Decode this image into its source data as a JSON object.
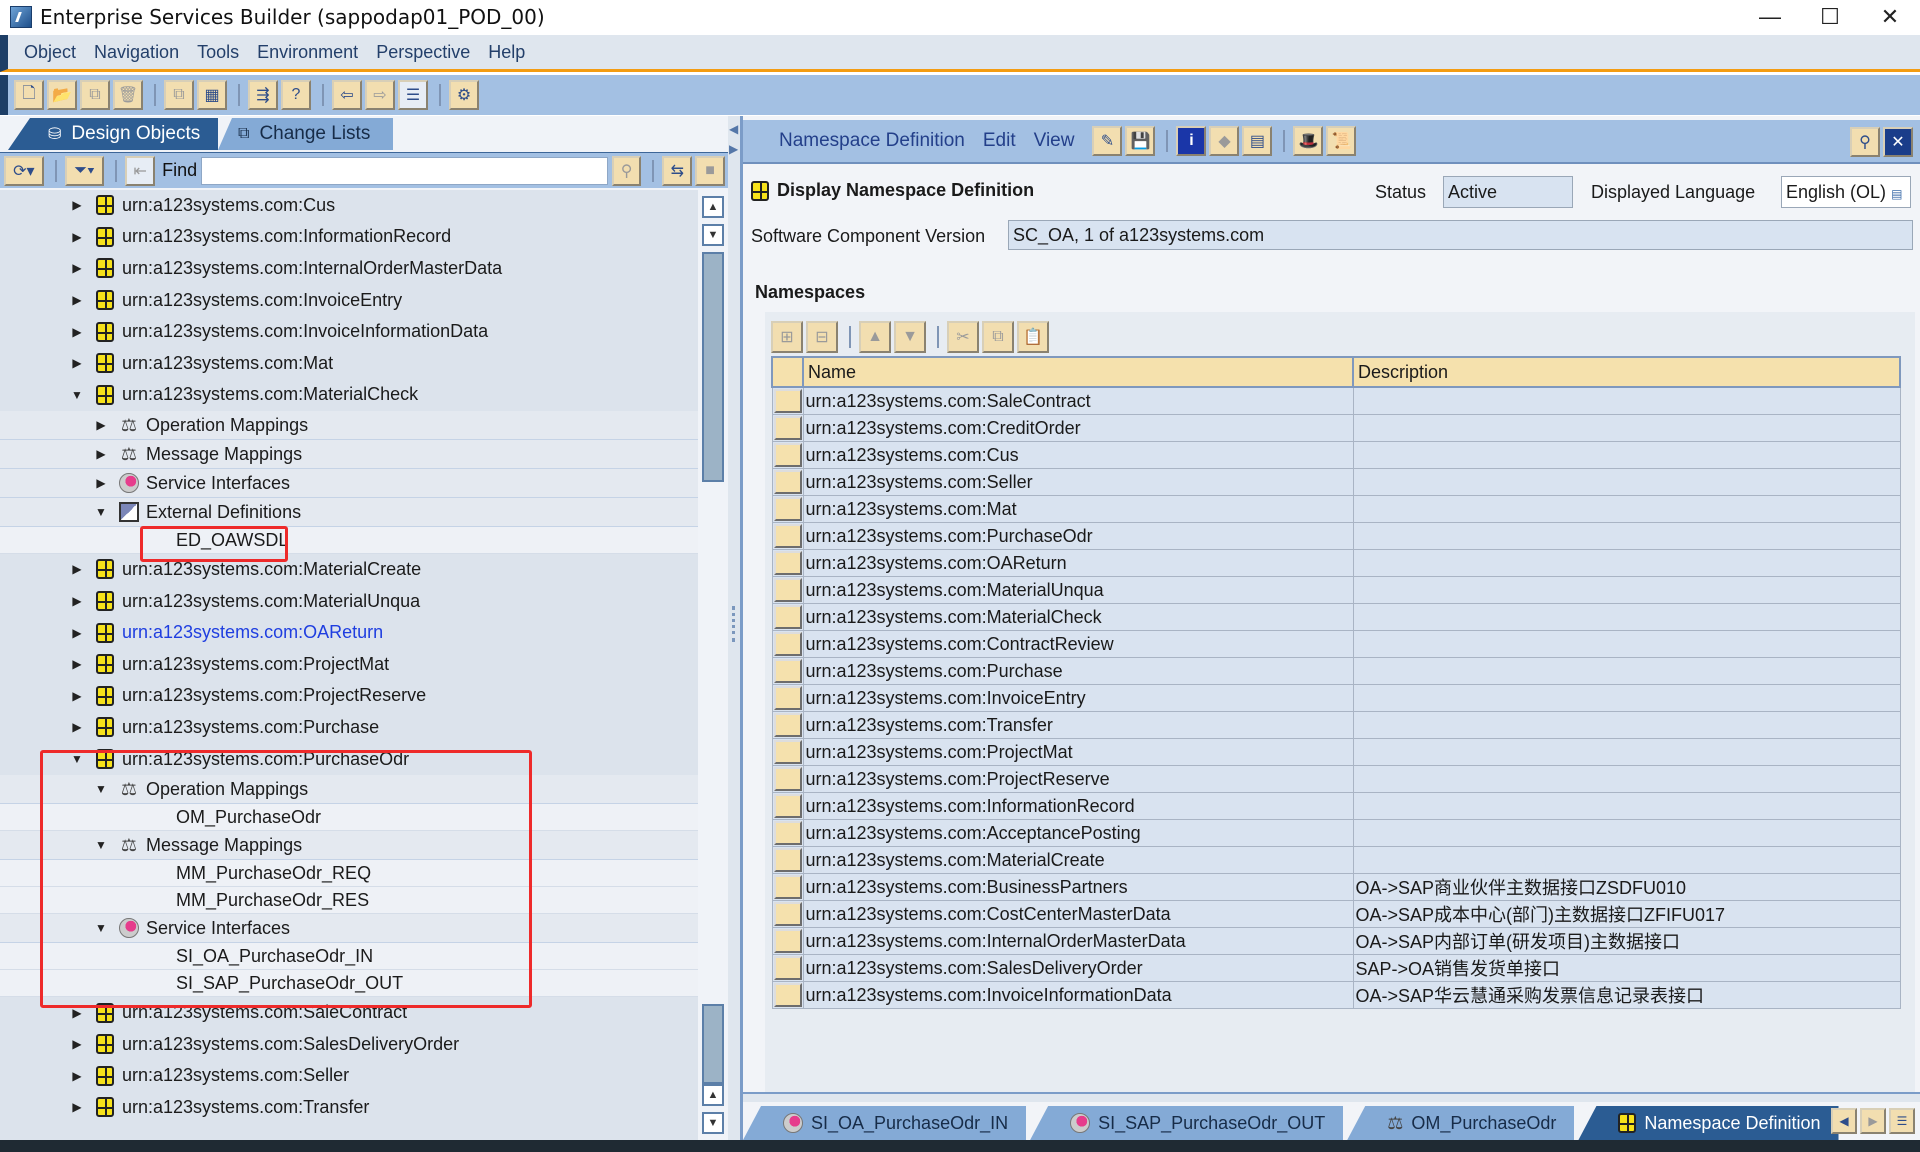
{
  "window": {
    "title": "Enterprise Services Builder (sappodap01_POD_00)",
    "controls": {
      "minimize": "—",
      "maximize": "☐",
      "close": "✕"
    }
  },
  "menubar": {
    "items": [
      {
        "label": "Object",
        "mnemonic": "O"
      },
      {
        "label": "Navigation",
        "mnemonic": "N"
      },
      {
        "label": "Tools",
        "mnemonic": "T"
      },
      {
        "label": "Environment",
        "mnemonic": "E"
      },
      {
        "label": "Perspective",
        "mnemonic": "P"
      },
      {
        "label": "Help",
        "mnemonic": "H"
      }
    ]
  },
  "toolbar": {
    "buttons": [
      {
        "name": "new-object",
        "glyph": "🗋",
        "enabled": true
      },
      {
        "name": "open",
        "glyph": "📂",
        "enabled": false
      },
      {
        "name": "copy",
        "glyph": "⧉",
        "enabled": false
      },
      {
        "name": "delete",
        "glyph": "🗑",
        "enabled": false
      },
      {
        "name": "copy-object",
        "glyph": "⧉",
        "enabled": false
      },
      {
        "name": "close-all",
        "glyph": "▦",
        "enabled": true
      },
      {
        "name": "where-used",
        "glyph": "⇶",
        "enabled": true
      },
      {
        "name": "help-doc",
        "glyph": "?",
        "enabled": true
      },
      {
        "name": "back",
        "glyph": "⇦",
        "enabled": true
      },
      {
        "name": "forward",
        "glyph": "⇨",
        "enabled": false
      },
      {
        "name": "toggle-navigation",
        "glyph": "☰",
        "enabled": true
      },
      {
        "name": "settings",
        "glyph": "⚙",
        "enabled": true
      }
    ]
  },
  "left_panel": {
    "tabs": [
      {
        "label": "Design Objects",
        "active": true,
        "icon": "database-icon"
      },
      {
        "label": "Change Lists",
        "active": false,
        "icon": "change-list-icon"
      }
    ],
    "find": {
      "label": "Find",
      "value": ""
    },
    "tree": [
      {
        "level": 0,
        "type": "namespace",
        "label": "urn:a123systems.com:Cus",
        "expanded": false
      },
      {
        "level": 0,
        "type": "namespace",
        "label": "urn:a123systems.com:InformationRecord",
        "expanded": false
      },
      {
        "level": 0,
        "type": "namespace",
        "label": "urn:a123systems.com:InternalOrderMasterData",
        "expanded": false
      },
      {
        "level": 0,
        "type": "namespace",
        "label": "urn:a123systems.com:InvoiceEntry",
        "expanded": false
      },
      {
        "level": 0,
        "type": "namespace",
        "label": "urn:a123systems.com:InvoiceInformationData",
        "expanded": false
      },
      {
        "level": 0,
        "type": "namespace",
        "label": "urn:a123systems.com:Mat",
        "expanded": false
      },
      {
        "level": 0,
        "type": "namespace",
        "label": "urn:a123systems.com:MaterialCheck",
        "expanded": true
      },
      {
        "level": 1,
        "type": "operation-mappings",
        "label": "Operation Mappings",
        "expanded": false
      },
      {
        "level": 1,
        "type": "message-mappings",
        "label": "Message Mappings",
        "expanded": false
      },
      {
        "level": 1,
        "type": "service-interfaces",
        "label": "Service Interfaces",
        "expanded": false
      },
      {
        "level": 1,
        "type": "external-definitions",
        "label": "External Definitions",
        "expanded": true
      },
      {
        "level": 2,
        "type": "object",
        "label": "ED_OAWSDL",
        "highlighted": true
      },
      {
        "level": 0,
        "type": "namespace",
        "label": "urn:a123systems.com:MaterialCreate",
        "expanded": false
      },
      {
        "level": 0,
        "type": "namespace",
        "label": "urn:a123systems.com:MaterialUnqua",
        "expanded": false
      },
      {
        "level": 0,
        "type": "namespace",
        "label": "urn:a123systems.com:OAReturn",
        "expanded": false,
        "link": true
      },
      {
        "level": 0,
        "type": "namespace",
        "label": "urn:a123systems.com:ProjectMat",
        "expanded": false
      },
      {
        "level": 0,
        "type": "namespace",
        "label": "urn:a123systems.com:ProjectReserve",
        "expanded": false
      },
      {
        "level": 0,
        "type": "namespace",
        "label": "urn:a123systems.com:Purchase",
        "expanded": false
      },
      {
        "level": 0,
        "type": "namespace",
        "label": "urn:a123systems.com:PurchaseOdr",
        "expanded": true,
        "highlighted": true
      },
      {
        "level": 1,
        "type": "operation-mappings",
        "label": "Operation Mappings",
        "expanded": true
      },
      {
        "level": 2,
        "type": "object",
        "label": "OM_PurchaseOdr"
      },
      {
        "level": 1,
        "type": "message-mappings",
        "label": "Message Mappings",
        "expanded": true
      },
      {
        "level": 2,
        "type": "object",
        "label": "MM_PurchaseOdr_REQ"
      },
      {
        "level": 2,
        "type": "object",
        "label": "MM_PurchaseOdr_RES"
      },
      {
        "level": 1,
        "type": "service-interfaces",
        "label": "Service Interfaces",
        "expanded": true
      },
      {
        "level": 2,
        "type": "object",
        "label": "SI_OA_PurchaseOdr_IN"
      },
      {
        "level": 2,
        "type": "object",
        "label": "SI_SAP_PurchaseOdr_OUT"
      },
      {
        "level": 0,
        "type": "namespace",
        "label": "urn:a123systems.com:SaleContract",
        "expanded": false
      },
      {
        "level": 0,
        "type": "namespace",
        "label": "urn:a123systems.com:SalesDeliveryOrder",
        "expanded": false
      },
      {
        "level": 0,
        "type": "namespace",
        "label": "urn:a123systems.com:Seller",
        "expanded": false
      },
      {
        "level": 0,
        "type": "namespace",
        "label": "urn:a123systems.com:Transfer",
        "expanded": false
      }
    ]
  },
  "right_panel": {
    "menu": [
      {
        "label": "Namespace Definition",
        "mnemonic": "a"
      },
      {
        "label": "Edit",
        "mnemonic": "d"
      },
      {
        "label": "View",
        "mnemonic": "V"
      }
    ],
    "heading": "Display Namespace Definition",
    "status_label": "Status",
    "status_value": "Active",
    "language_label": "Displayed Language",
    "language_value": "English (OL)",
    "scv_label": "Software Component Version",
    "scv_value": "SC_OA, 1 of a123systems.com",
    "section_title": "Namespaces",
    "table": {
      "columns": [
        "Name",
        "Description"
      ],
      "rows": [
        {
          "name": "urn:a123systems.com:SaleContract",
          "description": ""
        },
        {
          "name": "urn:a123systems.com:CreditOrder",
          "description": ""
        },
        {
          "name": "urn:a123systems.com:Cus",
          "description": ""
        },
        {
          "name": "urn:a123systems.com:Seller",
          "description": ""
        },
        {
          "name": "urn:a123systems.com:Mat",
          "description": ""
        },
        {
          "name": "urn:a123systems.com:PurchaseOdr",
          "description": ""
        },
        {
          "name": "urn:a123systems.com:OAReturn",
          "description": ""
        },
        {
          "name": "urn:a123systems.com:MaterialUnqua",
          "description": ""
        },
        {
          "name": "urn:a123systems.com:MaterialCheck",
          "description": ""
        },
        {
          "name": "urn:a123systems.com:ContractReview",
          "description": ""
        },
        {
          "name": "urn:a123systems.com:Purchase",
          "description": ""
        },
        {
          "name": "urn:a123systems.com:InvoiceEntry",
          "description": ""
        },
        {
          "name": "urn:a123systems.com:Transfer",
          "description": ""
        },
        {
          "name": "urn:a123systems.com:ProjectMat",
          "description": ""
        },
        {
          "name": "urn:a123systems.com:ProjectReserve",
          "description": ""
        },
        {
          "name": "urn:a123systems.com:InformationRecord",
          "description": ""
        },
        {
          "name": "urn:a123systems.com:AcceptancePosting",
          "description": ""
        },
        {
          "name": "urn:a123systems.com:MaterialCreate",
          "description": ""
        },
        {
          "name": "urn:a123systems.com:BusinessPartners",
          "description": "OA->SAP商业伙伴主数据接口ZSDFU010"
        },
        {
          "name": "urn:a123systems.com:CostCenterMasterData",
          "description": "OA->SAP成本中心(部门)主数据接口ZFIFU017"
        },
        {
          "name": "urn:a123systems.com:InternalOrderMasterData",
          "description": "OA->SAP内部订单(研发项目)主数据接口"
        },
        {
          "name": "urn:a123systems.com:SalesDeliveryOrder",
          "description": "SAP->OA销售发货单接口"
        },
        {
          "name": "urn:a123systems.com:InvoiceInformationData",
          "description": "OA->SAP华云慧通采购发票信息记录表接口"
        }
      ]
    },
    "editor_tabs": [
      {
        "label": "SI_OA_PurchaseOdr_IN",
        "icon": "service-interface-icon",
        "active": false
      },
      {
        "label": "SI_SAP_PurchaseOdr_OUT",
        "icon": "service-interface-icon",
        "active": false
      },
      {
        "label": "OM_PurchaseOdr",
        "icon": "operation-mapping-icon",
        "active": false
      },
      {
        "label": "Namespace Definition",
        "icon": "namespace-icon",
        "active": true
      }
    ]
  },
  "colors": {
    "accent_orange": "#f39c12",
    "toolbar_blue": "#a3c0e3",
    "active_tab": "#2b5c93",
    "highlight_red": "#ee2a2a",
    "link_blue": "#1f3ee0"
  }
}
